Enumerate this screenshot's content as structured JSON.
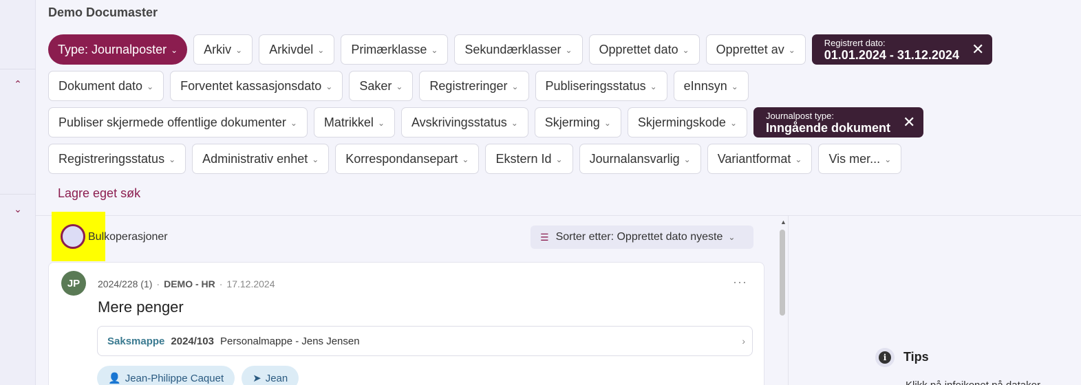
{
  "app": {
    "title": "Demo Documaster"
  },
  "filters": {
    "row1": [
      {
        "label": "Type: Journalposter",
        "style": "primary"
      },
      {
        "label": "Arkiv"
      },
      {
        "label": "Arkivdel"
      },
      {
        "label": "Primærklasse"
      },
      {
        "label": "Sekundærklasser"
      },
      {
        "label": "Opprettet dato"
      },
      {
        "label": "Opprettet av"
      }
    ],
    "registrert": {
      "small": "Registrert dato:",
      "value": "01.01.2024 - 31.12.2024"
    },
    "row2": [
      {
        "label": "Dokument dato"
      },
      {
        "label": "Forventet kassasjonsdato"
      },
      {
        "label": "Saker"
      },
      {
        "label": "Registreringer"
      },
      {
        "label": "Publiseringsstatus"
      },
      {
        "label": "eInnsyn"
      }
    ],
    "row3": [
      {
        "label": "Publiser skjermede offentlige dokumenter"
      },
      {
        "label": "Matrikkel"
      },
      {
        "label": "Avskrivingsstatus"
      },
      {
        "label": "Skjerming"
      },
      {
        "label": "Skjermingskode"
      }
    ],
    "journalpost_type": {
      "small": "Journalpost type:",
      "value": "Inngående dokument"
    },
    "row4": [
      {
        "label": "Registreringsstatus"
      },
      {
        "label": "Administrativ enhet"
      },
      {
        "label": "Korrespondansepart"
      },
      {
        "label": "Ekstern Id"
      },
      {
        "label": "Journalansvarlig"
      },
      {
        "label": "Variantformat"
      },
      {
        "label": "Vis mer..."
      }
    ],
    "save_search": "Lagre eget søk"
  },
  "list": {
    "bulk_label": "Bulkoperasjoner",
    "sort_label": "Sorter etter: Opprettet dato nyeste",
    "card": {
      "avatar": "JP",
      "number": "2024/228 (1)",
      "dept": "DEMO - HR",
      "date": "17.12.2024",
      "more": "···",
      "title": "Mere penger",
      "case": {
        "type": "Saksmappe",
        "number": "2024/103",
        "name": "Personalmappe - Jens Jensen"
      },
      "tags": [
        {
          "icon": "user-icon",
          "label": "Jean-Philippe Caquet"
        },
        {
          "icon": "send-icon",
          "label": "Jean"
        }
      ]
    }
  },
  "tips": {
    "title": "Tips",
    "text": "Klikk på infoikonet på datakor"
  },
  "colors": {
    "accent": "#8b1d4f",
    "dark_chip": "#3c1f35"
  }
}
